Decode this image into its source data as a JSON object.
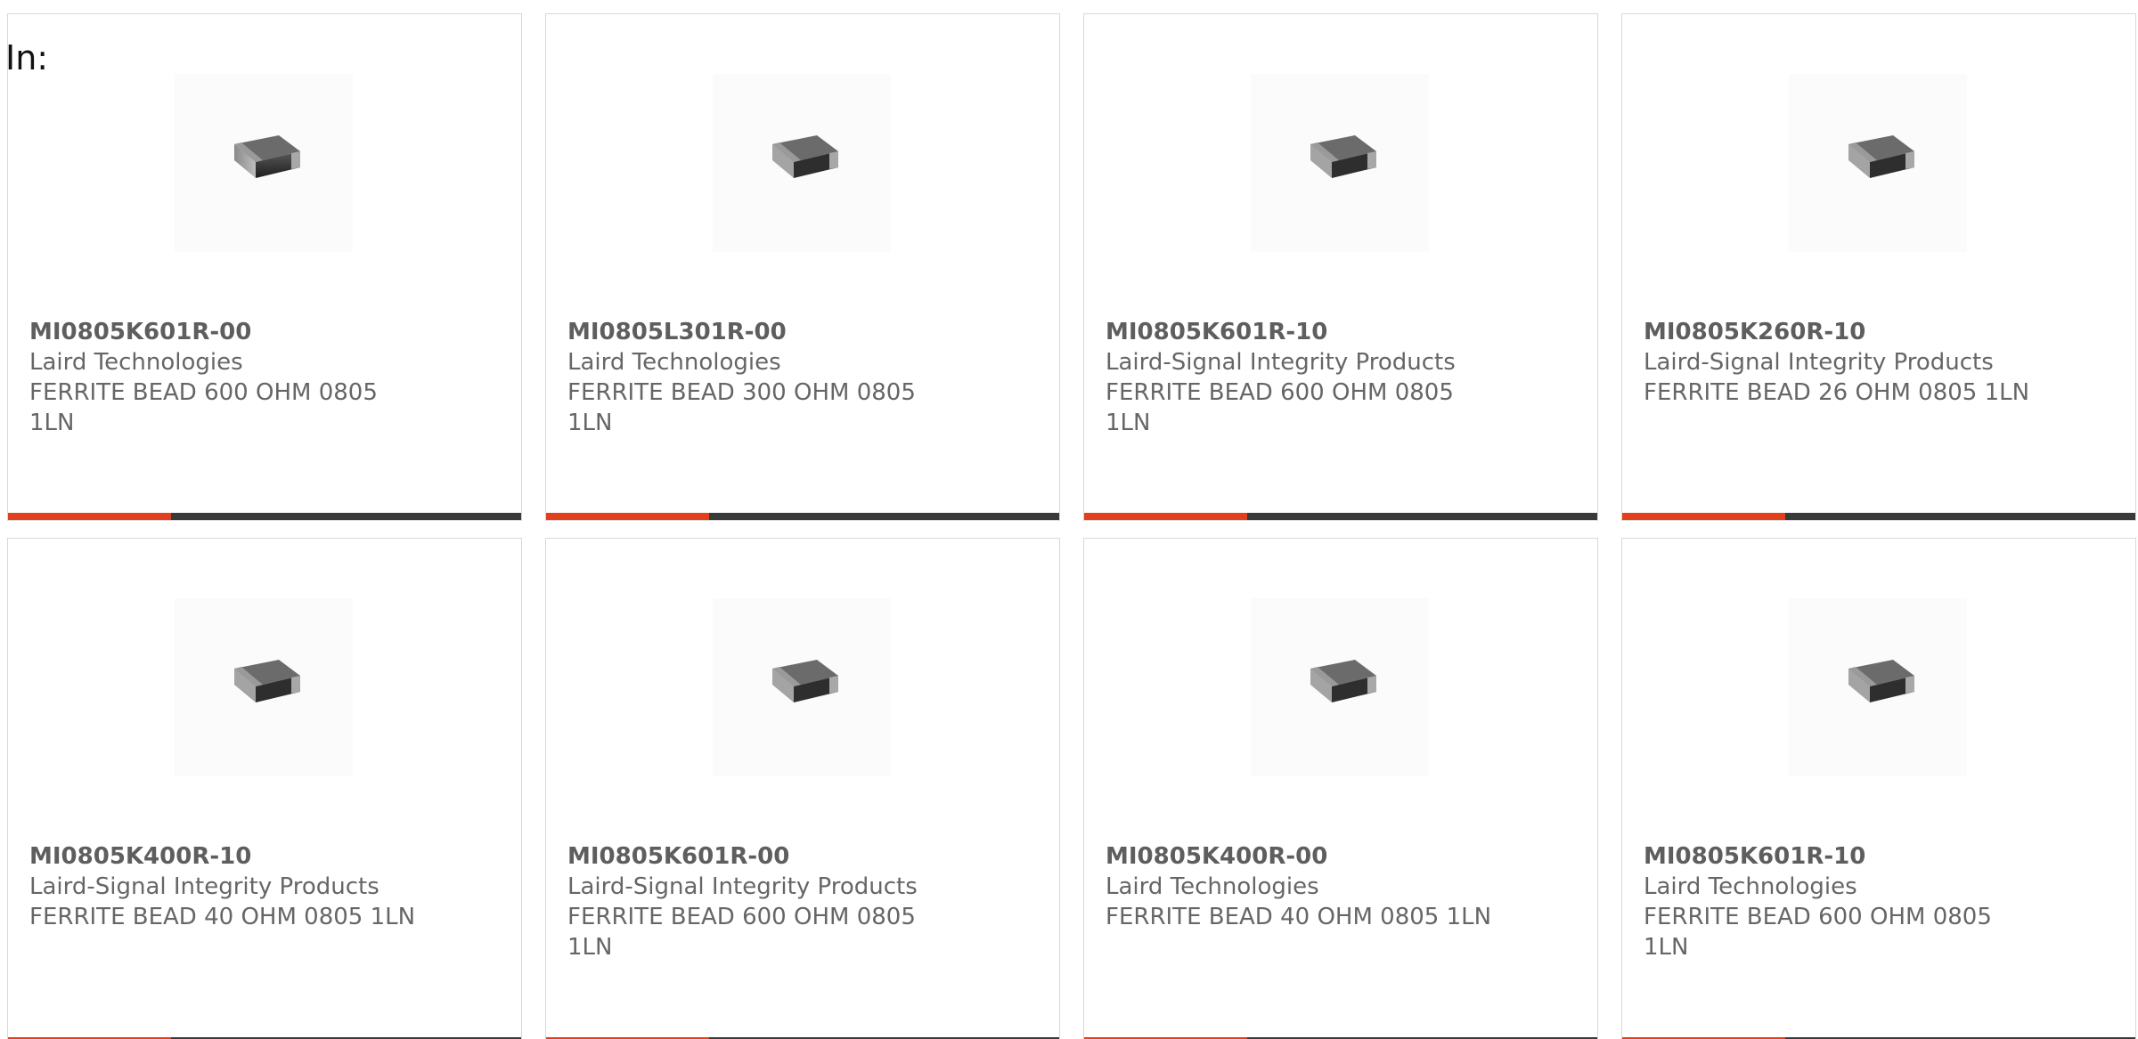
{
  "header": {
    "in_label": "In:"
  },
  "colors": {
    "accent": "#e2401c",
    "bar": "#3a3a3a",
    "text": "#666666"
  },
  "products": [
    {
      "part": "MI0805K601R-00",
      "manufacturer": "Laird Technologies",
      "description": "FERRITE BEAD 600 OHM 0805 1LN",
      "image_icon": "ferrite-bead-chip-icon"
    },
    {
      "part": "MI0805L301R-00",
      "manufacturer": "Laird Technologies",
      "description": "FERRITE BEAD 300 OHM 0805 1LN",
      "image_icon": "ferrite-bead-chip-icon"
    },
    {
      "part": "MI0805K601R-10",
      "manufacturer": "Laird-Signal Integrity Products",
      "description": "FERRITE BEAD 600 OHM 0805 1LN",
      "image_icon": "ferrite-bead-chip-icon"
    },
    {
      "part": "MI0805K260R-10",
      "manufacturer": "Laird-Signal Integrity Products",
      "description": "FERRITE BEAD 26 OHM 0805 1LN",
      "image_icon": "ferrite-bead-chip-icon"
    },
    {
      "part": "MI0805K400R-10",
      "manufacturer": "Laird-Signal Integrity Products",
      "description": "FERRITE BEAD 40 OHM 0805 1LN",
      "image_icon": "ferrite-bead-chip-icon"
    },
    {
      "part": "MI0805K601R-00",
      "manufacturer": "Laird-Signal Integrity Products",
      "description": "FERRITE BEAD 600 OHM 0805 1LN",
      "image_icon": "ferrite-bead-chip-icon"
    },
    {
      "part": "MI0805K400R-00",
      "manufacturer": "Laird Technologies",
      "description": "FERRITE BEAD 40 OHM 0805 1LN",
      "image_icon": "ferrite-bead-chip-icon"
    },
    {
      "part": "MI0805K601R-10",
      "manufacturer": "Laird Technologies",
      "description": "FERRITE BEAD 600 OHM 0805 1LN",
      "image_icon": "ferrite-bead-chip-icon"
    }
  ]
}
